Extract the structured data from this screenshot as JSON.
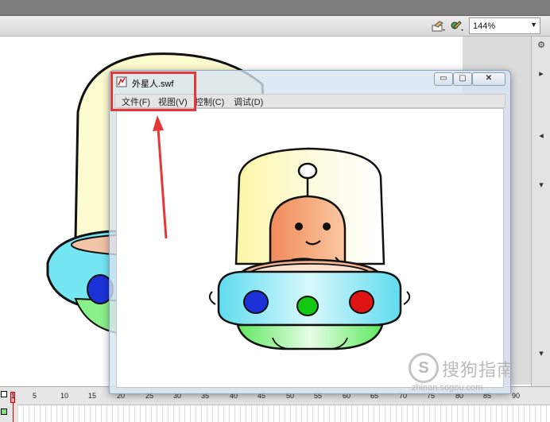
{
  "toolbar": {
    "zoom_value": "144%",
    "icons": [
      "edit-symbols-icon",
      "edit-scene-icon"
    ]
  },
  "player": {
    "title": "外星人.swf",
    "menu": [
      "文件(F)",
      "视图(V)",
      "控制(C)",
      "调试(D)"
    ],
    "controls": {
      "minimize": "▭",
      "maximize": "▢",
      "close": "✕"
    }
  },
  "timeline": {
    "ruler": [
      "1",
      "5",
      "10",
      "15",
      "20",
      "25",
      "30",
      "35",
      "40",
      "45",
      "50",
      "55",
      "60",
      "65",
      "70",
      "75",
      "80",
      "85",
      "90"
    ],
    "current_frame": "1"
  },
  "watermark": {
    "logo": "S",
    "name": "搜狗指南",
    "domain": "zhinan.sogou.com"
  },
  "colors": {
    "annotation": "#e43838",
    "dome": "#fdf9b8",
    "alien": "#f2a079",
    "saucer_ring": "#6ee0f0",
    "saucer_bottom": "#7af07a",
    "light_blue": "#1c32d8",
    "light_green": "#12c812",
    "light_red": "#e01414"
  }
}
